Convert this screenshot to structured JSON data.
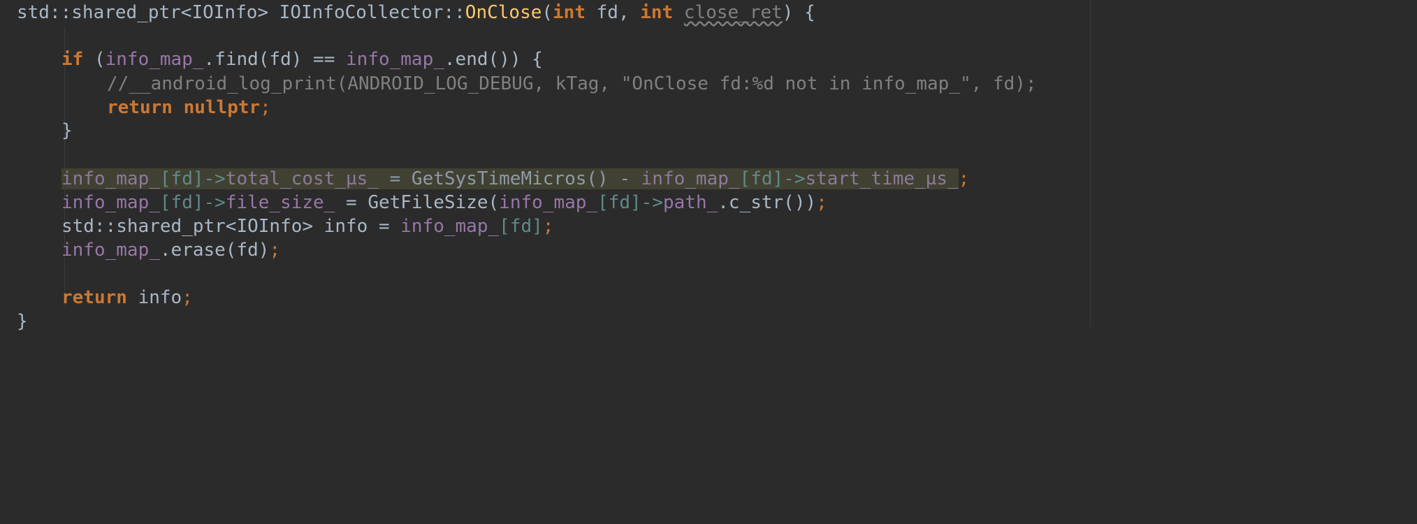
{
  "editor": {
    "theme_colors": {
      "background": "#2b2b2b",
      "keyword": "#cc7832",
      "function": "#ffc66d",
      "member": "#9876aa",
      "comment": "#808080",
      "default": "#a9b7c6",
      "highlight": "#414133"
    },
    "lines": {
      "l1": {
        "a": "std::shared_ptr<IOInfo> IOInfoCollector::",
        "fn": "OnClose",
        "b": "(",
        "kw1": "int",
        "c": " fd, ",
        "kw2": "int",
        "d": " ",
        "unused": "close_ret",
        "e": ") {"
      },
      "l2": {
        "kw": "if",
        "a": " (",
        "m1": "info_map_",
        "b": ".find(fd) == ",
        "m2": "info_map_",
        "c": ".end()) {"
      },
      "l3": {
        "comment": "//__android_log_print(ANDROID_LOG_DEBUG, kTag, \"OnClose fd:%d not in info_map_\", fd);"
      },
      "l4": {
        "kw1": "return",
        "a": " ",
        "kw2": "nullptr",
        "semi": ";"
      },
      "l5": {
        "a": "}"
      },
      "l6": {
        "m1": "info_map_",
        "b1": "[fd]->",
        "m2": "total_cost_µs_",
        "a": " = GetSysTimeMicros() - ",
        "m3": "info_map_",
        "b2": "[fd]->",
        "m4": "start_time_µs_",
        "semi": ";"
      },
      "l7": {
        "m1": "info_map_",
        "b1": "[fd]->",
        "m2": "file_size_",
        "a": " = GetFileSize(",
        "m3": "info_map_",
        "b2": "[fd]->",
        "m4": "path_",
        "b": ".c_str())",
        "semi": ";"
      },
      "l8": {
        "a": "std::shared_ptr<IOInfo> info = ",
        "m1": "info_map_",
        "b": "[fd]",
        "semi": ";"
      },
      "l9": {
        "m1": "info_map_",
        "a": ".erase(fd)",
        "semi": ";"
      },
      "l10": {
        "kw": "return",
        "a": " info",
        "semi": ";"
      },
      "l11": {
        "a": "}"
      }
    }
  }
}
